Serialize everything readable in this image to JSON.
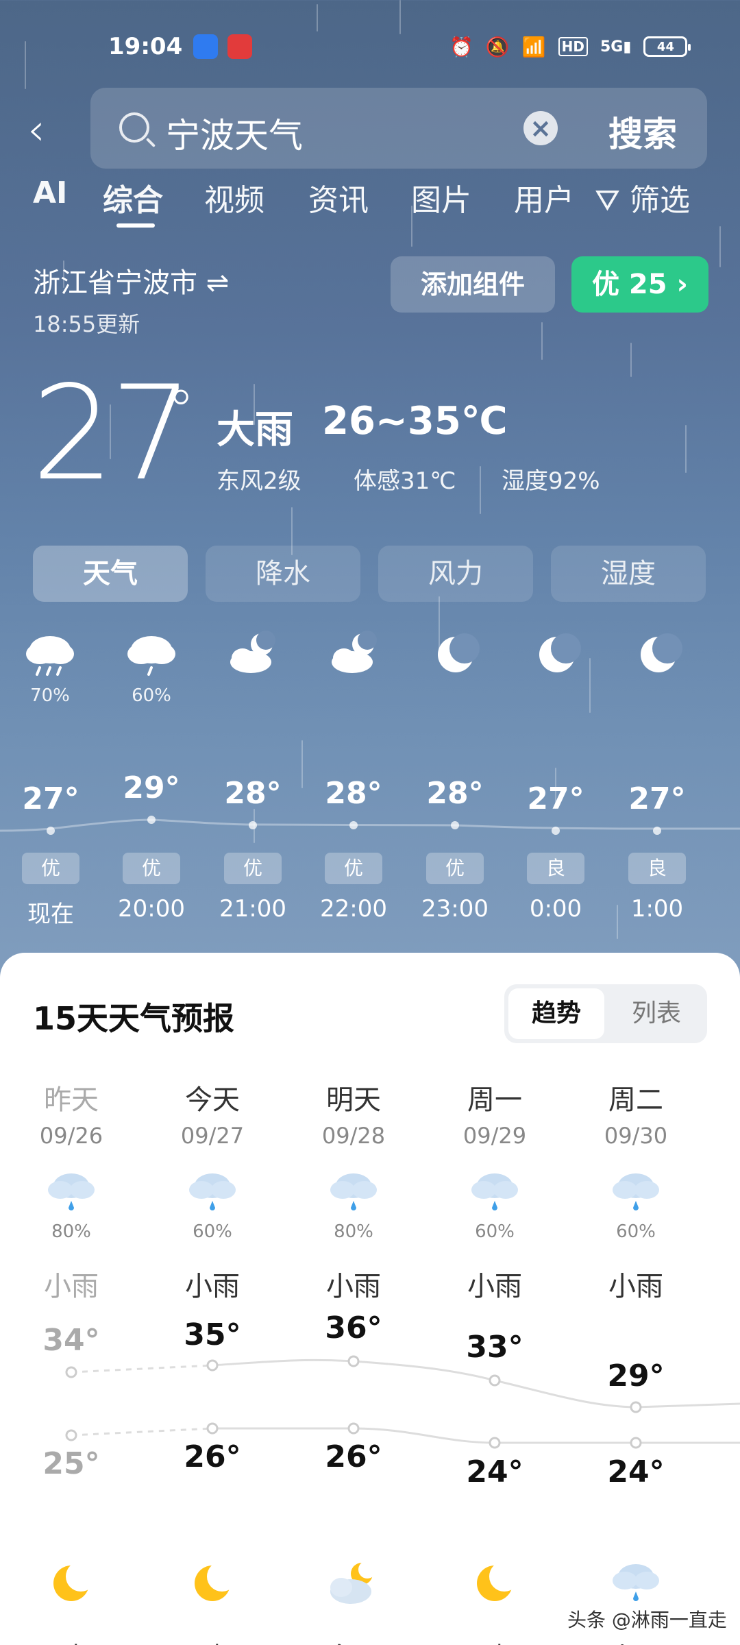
{
  "status": {
    "time": "19:04",
    "battery": "44"
  },
  "search": {
    "query": "宁波天气",
    "button": "搜索"
  },
  "tabs": [
    "AI",
    "综合",
    "视频",
    "资讯",
    "图片",
    "用户",
    "筛选"
  ],
  "location": {
    "name": "浙江省宁波市 ⇌",
    "updated": "18:55更新",
    "add_widget": "添加组件",
    "aqi": "优 25 ›"
  },
  "current": {
    "temp": "27",
    "deg": "°",
    "condition": "大雨",
    "range": "26~35℃",
    "wind": "东风2级",
    "feels": "体感31℃",
    "humidity": "湿度92%"
  },
  "segments": [
    "天气",
    "降水",
    "风力",
    "湿度"
  ],
  "hourly": [
    {
      "icon": "rain-cloud-icon",
      "prob": "70%",
      "temp": "27°",
      "aqi": "优",
      "time": "现在"
    },
    {
      "icon": "rain-cloud-icon",
      "prob": "60%",
      "temp": "29°",
      "aqi": "优",
      "time": "20:00"
    },
    {
      "icon": "cloudy-night-icon",
      "prob": "",
      "temp": "28°",
      "aqi": "优",
      "time": "21:00"
    },
    {
      "icon": "cloudy-night-icon",
      "prob": "",
      "temp": "28°",
      "aqi": "优",
      "time": "22:00"
    },
    {
      "icon": "moon-icon",
      "prob": "",
      "temp": "28°",
      "aqi": "优",
      "time": "23:00"
    },
    {
      "icon": "moon-icon",
      "prob": "",
      "temp": "27°",
      "aqi": "良",
      "time": "0:00"
    },
    {
      "icon": "moon-icon",
      "prob": "",
      "temp": "27°",
      "aqi": "良",
      "time": "1:00"
    }
  ],
  "forecast": {
    "title": "15天天气预报",
    "toggle_trend": "趋势",
    "toggle_list": "列表",
    "days": [
      {
        "name": "昨天",
        "date": "09/26",
        "prob": "80%",
        "cond": "小雨",
        "hi": "34°",
        "lo": "25°",
        "night_icon": "moon-icon",
        "night_cond": "晴"
      },
      {
        "name": "今天",
        "date": "09/27",
        "prob": "60%",
        "cond": "小雨",
        "hi": "35°",
        "lo": "26°",
        "night_icon": "moon-icon",
        "night_cond": "晴"
      },
      {
        "name": "明天",
        "date": "09/28",
        "prob": "80%",
        "cond": "小雨",
        "hi": "36°",
        "lo": "26°",
        "night_icon": "cloudy-night-icon",
        "night_cond": "多云"
      },
      {
        "name": "周一",
        "date": "09/29",
        "prob": "60%",
        "cond": "小雨",
        "hi": "33°",
        "lo": "24°",
        "night_icon": "moon-icon",
        "night_cond": "晴"
      },
      {
        "name": "周二",
        "date": "09/30",
        "prob": "60%",
        "cond": "小雨",
        "hi": "29°",
        "lo": "24°",
        "night_icon": "rain-cloud-icon",
        "night_cond": "小雨"
      }
    ]
  },
  "watermark": "头条 @淋雨一直走"
}
